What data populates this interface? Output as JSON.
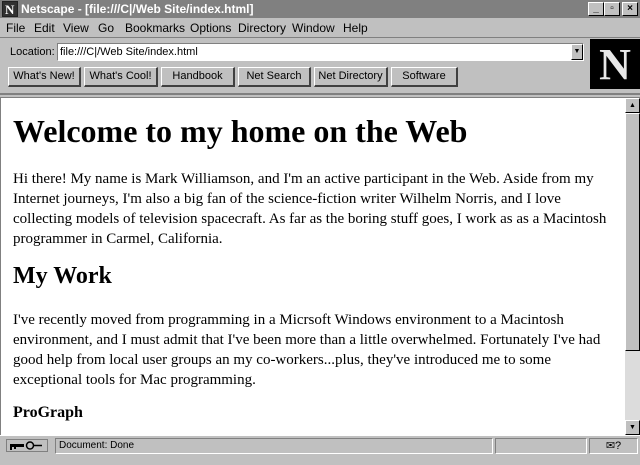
{
  "window": {
    "title": "Netscape - [file:///C|/Web Site/index.html]",
    "minimize_label": "_",
    "maximize_label": "▫",
    "close_label": "×"
  },
  "menu": [
    {
      "label": "File"
    },
    {
      "label": "Edit"
    },
    {
      "label": "View"
    },
    {
      "label": "Go"
    },
    {
      "label": "Bookmarks"
    },
    {
      "label": "Options"
    },
    {
      "label": "Directory"
    },
    {
      "label": "Window"
    },
    {
      "label": "Help"
    }
  ],
  "location": {
    "label": "Location:",
    "value": "file:///C|/Web Site/index.html"
  },
  "directory_buttons": [
    {
      "label": "What's New!"
    },
    {
      "label": "What's Cool!"
    },
    {
      "label": "Handbook"
    },
    {
      "label": "Net Search"
    },
    {
      "label": "Net Directory"
    },
    {
      "label": "Software"
    }
  ],
  "logo": {
    "letter": "N"
  },
  "page": {
    "heading": "Welcome to my home on the Web",
    "intro": "Hi there! My name is Mark Williamson, and I'm an active participant in the Web. Aside from my Internet journeys, I'm also a big fan of the science-fiction writer Wilhelm Norris, and I love collecting models of television spacecraft. As far as the boring stuff goes, I work as as a Macintosh programmer in Carmel, California.",
    "section_heading": "My Work",
    "work_text": "I've recently moved from programming in a Micrsoft Windows environment to a Macintosh environment, and I must admit that I've been more than a little overwhelmed. Fortunately I've had good help from local user groups an my co-workers...plus, they've introduced me to some exceptional tools for Mac programming.",
    "subheading": "ProGraph"
  },
  "status": {
    "text": "Document: Done",
    "progress": "",
    "mail": "✉?"
  },
  "icons": {
    "security": "key-icon",
    "mail": "mail-icon",
    "app": "netscape-icon"
  }
}
